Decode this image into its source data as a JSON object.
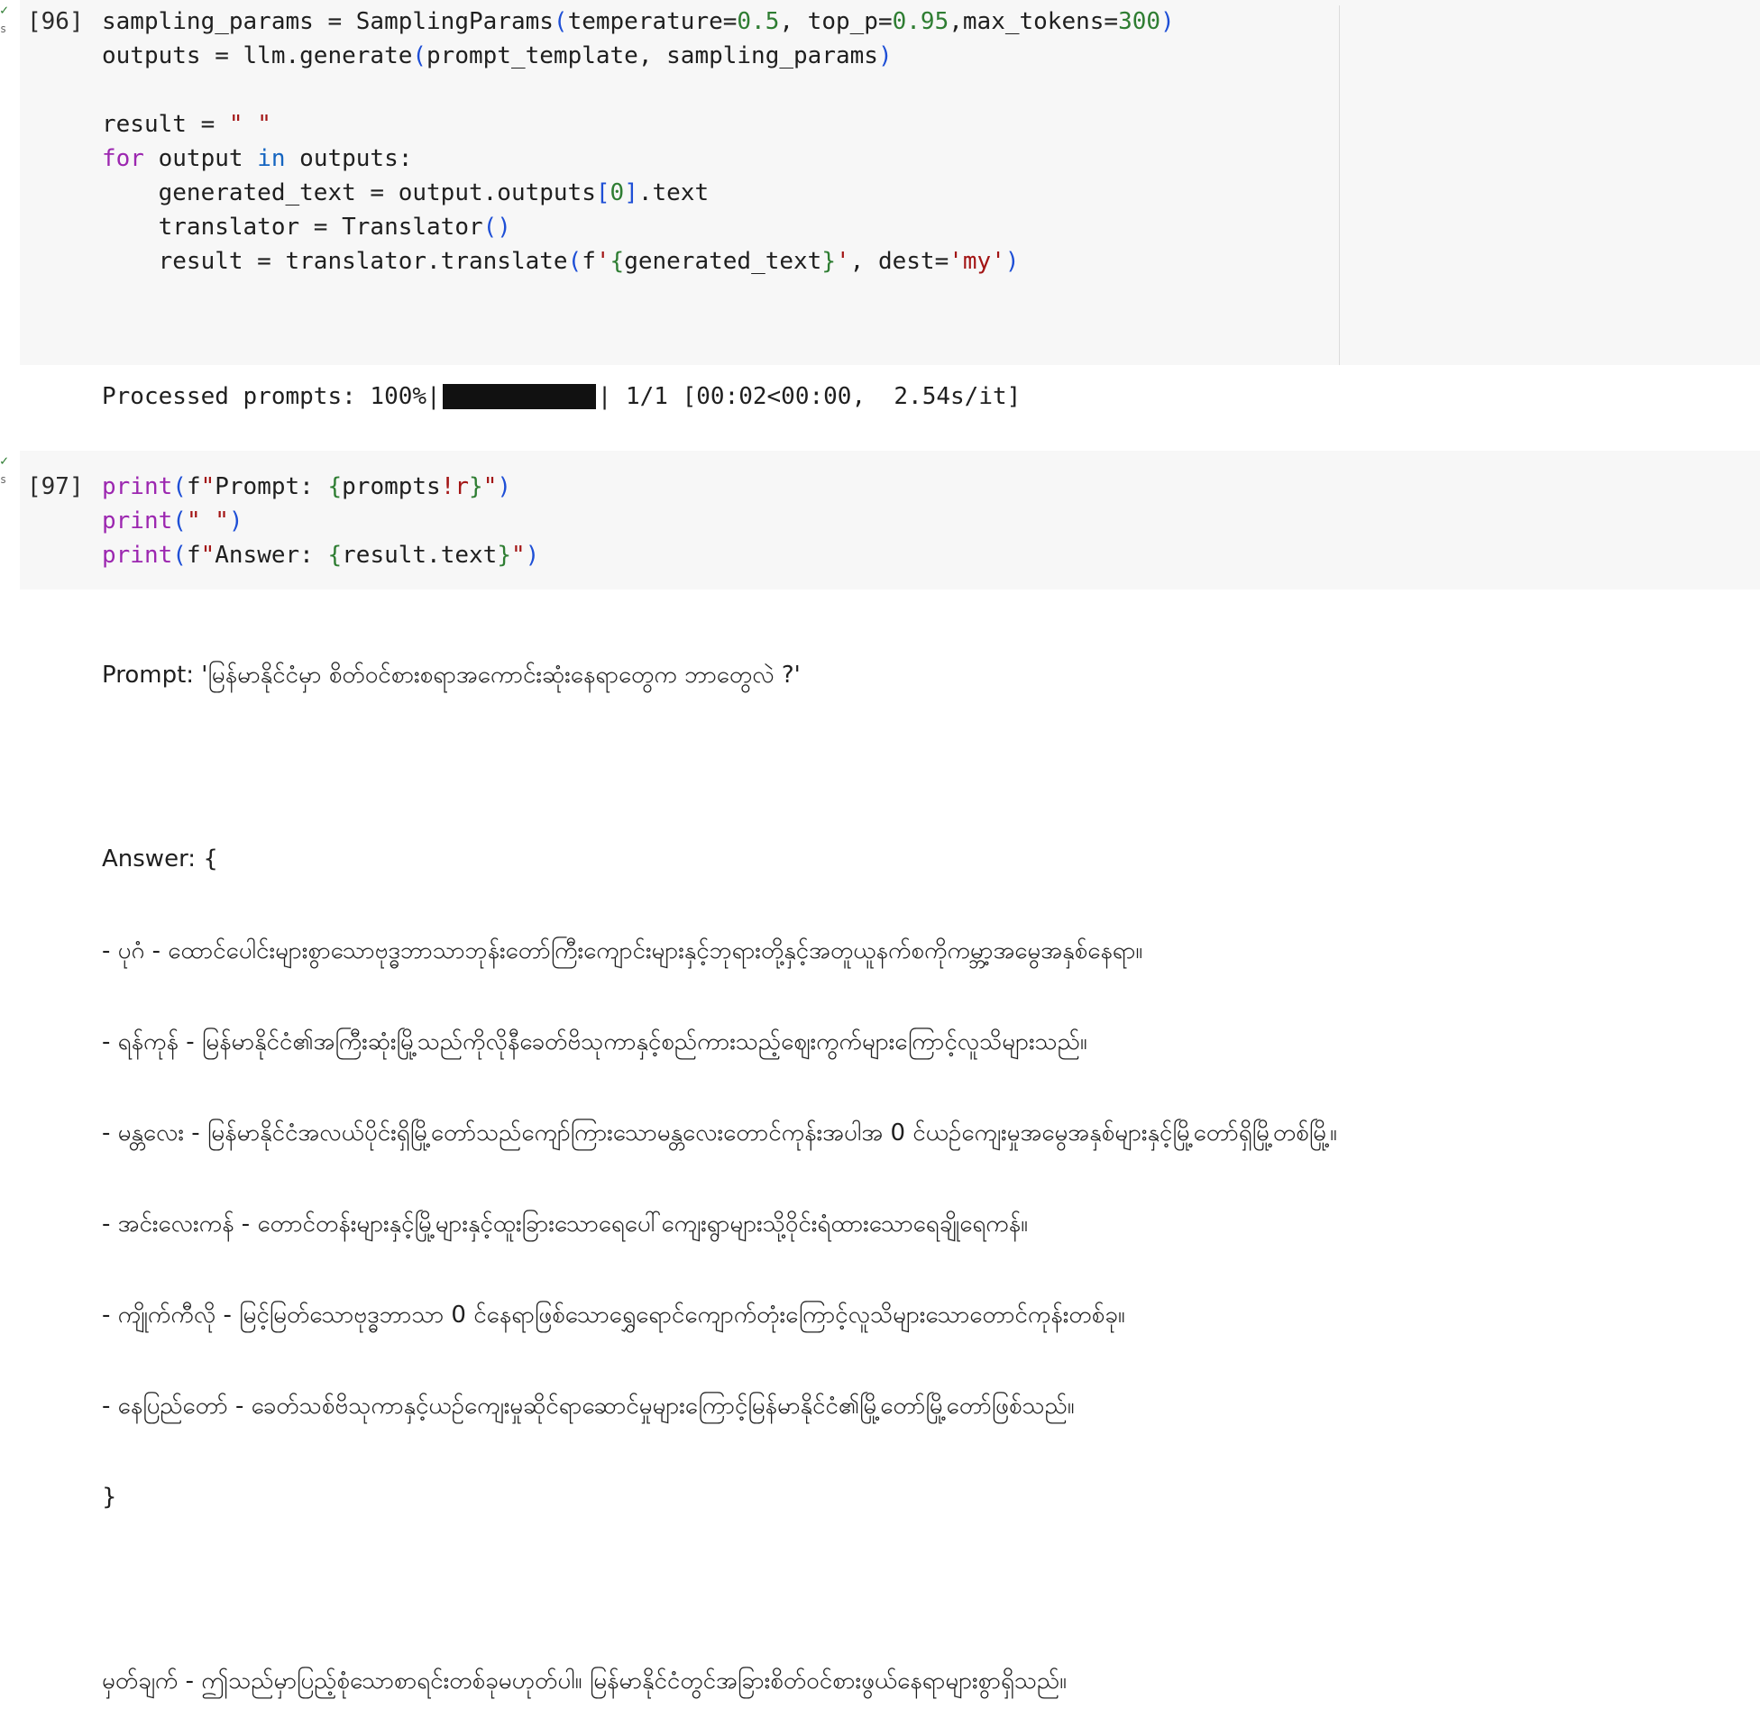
{
  "cells": [
    {
      "execution_count": "[96]",
      "status_mark": "✓",
      "status_sub": "s",
      "code_lines": [
        "sampling_params = SamplingParams(temperature=0.5, top_p=0.95,max_tokens=300)",
        "outputs = llm.generate(prompt_template, sampling_params)",
        "",
        "result = \" \"",
        "for output in outputs:",
        "    generated_text = output.outputs[0].text",
        "    translator = Translator()",
        "    result = translator.translate(f'{generated_text}', dest='my')"
      ],
      "output": {
        "progress_prefix": "Processed prompts: 100%|",
        "progress_value": 1.0,
        "progress_suffix": "| 1/1 [00:02<00:00,  2.54s/it]"
      }
    },
    {
      "execution_count": "[97]",
      "status_mark": "✓",
      "status_sub": "s",
      "code_lines": [
        "print(f\"Prompt: {prompts!r}\")",
        "print(\" \")",
        "print(f\"Answer: {result.text}\")"
      ],
      "output_lines": [
        "Prompt: 'မြန်မာနိုင်ငံမှာ စိတ်ဝင်စားစရာအကောင်းဆုံးနေရာတွေက ဘာတွေလဲ ?'",
        "",
        "Answer: {",
        "- ပုဂံ - ထောင်ပေါင်းများစွာသောဗုဒ္ဓဘာသာဘုန်းတော်ကြီးကျောင်းများနှင့်ဘုရားတို့နှင့်အတူယူနက်စကိုကမ္ဘာ့အမွေအနှစ်နေရာ။",
        "- ရန်ကုန် - မြန်မာနိုင်ငံ၏အကြီးဆုံးမြို့သည်ကိုလိုနီခေတ်ဗိသုကာနှင့်စည်ကားသည့်ဈေးကွက်များကြောင့်လူသိများသည်။",
        "- မန္တလေး - မြန်မာနိုင်ငံအလယ်ပိုင်းရှိမြို့တော်သည်ကျော်ကြားသောမန္တလေးတောင်ကုန်းအပါအ 0 င်ယဉ်ကျေးမှုအမွေအနှစ်များနှင့်မြို့တော်ရှိမြို့တစ်မြို့။",
        "- အင်းလေးကန် - တောင်တန်းများနှင့်မြို့များနှင့်ထူးခြားသောရေပေါ်ကျေးရွာများသို့ဝိုင်းရံထားသောရေချိုရေကန်။",
        "- ကျိုက်ကီလို - မြင့်မြတ်သောဗုဒ္ဓဘာသာ 0 င်နေရာဖြစ်သောရွှေရောင်ကျောက်တုံးကြောင့်လူသိများသောတောင်ကုန်းတစ်ခု။",
        "- နေပြည်တော် - ခေတ်သစ်ဗိသုကာနှင့်ယဉ်ကျေးမှုဆိုင်ရာဆောင်မှုများကြောင့်မြန်မာနိုင်ငံ၏မြို့တော်မြို့တော်ဖြစ်သည်။",
        "}",
        "",
        "မှတ်ချက် - ဤသည်မှာပြည့်စုံသောစာရင်းတစ်ခုမဟုတ်ပါ။ မြန်မာနိုင်ငံတွင်အခြားစိတ်ဝင်စားဖွယ်နေရာများစွာရှိသည်။"
      ]
    }
  ]
}
